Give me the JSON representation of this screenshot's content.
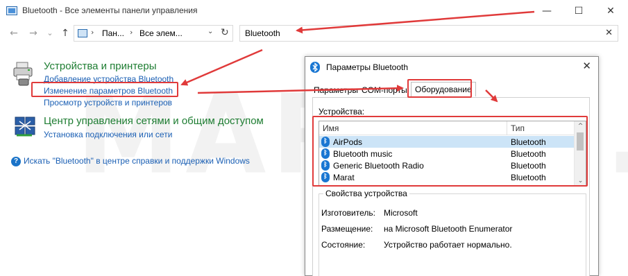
{
  "window": {
    "title": "Bluetooth - Все элементы панели управления",
    "minimize_glyph": "—",
    "maximize_glyph": "☐",
    "close_glyph": "✕"
  },
  "nav": {
    "back_glyph": "←",
    "forward_glyph": "→",
    "recent_glyph": "⌄",
    "up_glyph": "↑",
    "address_crumbs": [
      "Пан...",
      "Все элем..."
    ],
    "crumb_separator": "›",
    "address_dropdown_glyph": "⌄",
    "refresh_glyph": "↻",
    "search_value": "Bluetooth",
    "search_clear_glyph": "✕"
  },
  "watermark": "MARREX.RU",
  "left_panel": {
    "categories": [
      {
        "title": "Устройства и принтеры",
        "icon": "devices-printers-icon",
        "links": [
          "Добавление устройства Bluetooth",
          "Изменение параметров Bluetooth",
          "Просмотр устройств и принтеров"
        ]
      },
      {
        "title": "Центр управления сетями и общим доступом",
        "icon": "network-center-icon",
        "links": [
          "Установка подключения или сети"
        ]
      }
    ],
    "help_icon_glyph": "?",
    "help_link": "Искать \"Bluetooth\" в центре справки и поддержки Windows"
  },
  "dialog": {
    "title": "Параметры Bluetooth",
    "close_glyph": "✕",
    "tabs": [
      "Параметры",
      "COM-порты",
      "Оборудование"
    ],
    "active_tab": "Оборудование",
    "devices_label": "Устройства:",
    "columns": [
      "Имя",
      "Тип"
    ],
    "devices": [
      {
        "name": "AirPods",
        "type": "Bluetooth",
        "selected": true
      },
      {
        "name": "Bluetooth music",
        "type": "Bluetooth",
        "selected": false
      },
      {
        "name": "Generic Bluetooth Radio",
        "type": "Bluetooth",
        "selected": false
      },
      {
        "name": "Marat",
        "type": "Bluetooth",
        "selected": false
      }
    ],
    "bluetooth_glyph": "ᛒ",
    "scroll_up_glyph": "^",
    "scroll_down_glyph": "⌄",
    "properties": {
      "legend": "Свойства устройства",
      "rows": [
        {
          "label": "Изготовитель:",
          "value": "Microsoft"
        },
        {
          "label": "Размещение:",
          "value": "на Microsoft Bluetooth Enumerator"
        },
        {
          "label": "Состояние:",
          "value": "Устройство работает нормально."
        }
      ]
    }
  },
  "annotation_color": "#e03a3a"
}
